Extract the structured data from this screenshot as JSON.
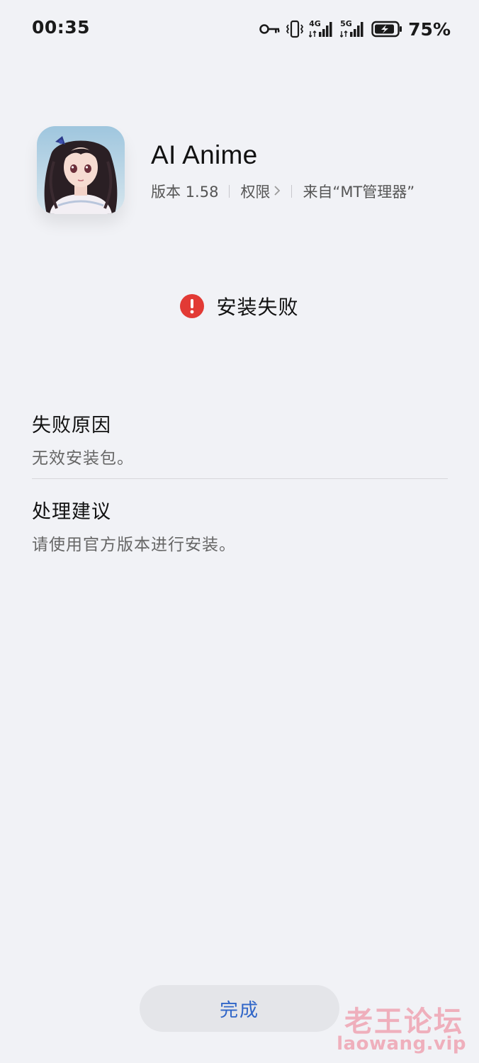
{
  "status_bar": {
    "time": "00:35",
    "network_1": "4G",
    "network_2": "5G",
    "battery_percent": "75%",
    "icons": [
      "vpn-key-icon",
      "vibrate-icon",
      "signal-4g-icon",
      "signal-5g-icon",
      "battery-charging-icon"
    ]
  },
  "app": {
    "name": "AI Anime",
    "version_label": "版本 1.58",
    "permissions_label": "权限",
    "source_label": "来自“MT管理器”",
    "icon": "anime-girl-app-icon"
  },
  "result": {
    "status_text": "安装失败",
    "icon": "error-icon",
    "color": "#e23a35"
  },
  "failure_reason": {
    "title": "失败原因",
    "body": "无效安装包。"
  },
  "suggestion": {
    "title": "处理建议",
    "body": "请使用官方版本进行安装。"
  },
  "done_button": {
    "label": "完成",
    "color": "#2f65c8"
  },
  "watermark": {
    "text_cn": "老王论坛",
    "text_en": "laowang.vip"
  }
}
